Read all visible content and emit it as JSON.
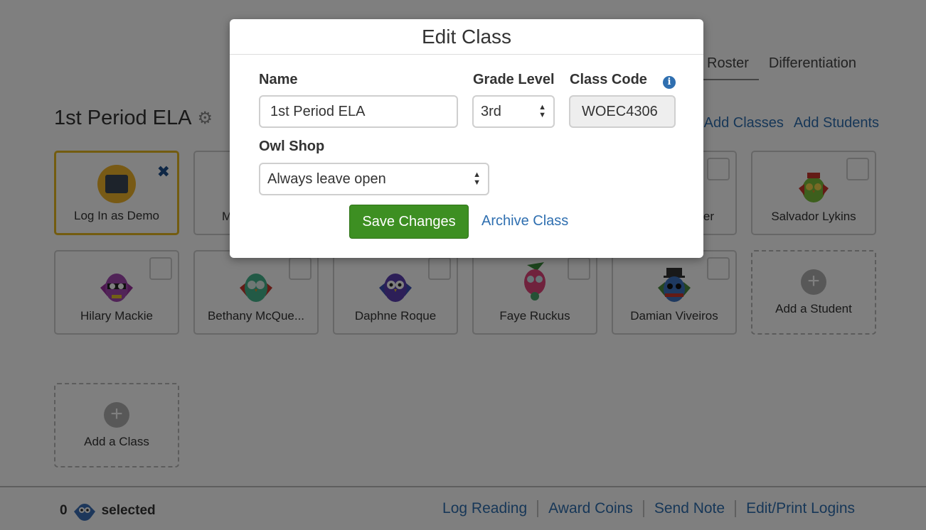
{
  "tabs": [
    {
      "label": "Roster",
      "active": true
    },
    {
      "label": "Differentiation",
      "active": false
    }
  ],
  "class_title": "1st Period ELA",
  "top_links": {
    "add_classes": "Add Classes",
    "add_students": "Add Students"
  },
  "cards": {
    "demo": "Log In as Demo",
    "row1_partial_2": "M",
    "row1_partial_5": "er",
    "salvador": "Salvador Lykins",
    "hilary": "Hilary Mackie",
    "bethany": "Bethany McQue...",
    "daphne": "Daphne Roque",
    "faye": "Faye Ruckus",
    "damian": "Damian Viveiros",
    "add_student": "Add a Student",
    "add_class": "Add a Class"
  },
  "bottom_bar": {
    "count": "0",
    "selected_label": "selected",
    "links": [
      "Log Reading",
      "Award Coins",
      "Send Note",
      "Edit/Print Logins"
    ]
  },
  "modal": {
    "title": "Edit Class",
    "name_label": "Name",
    "name_value": "1st Period ELA",
    "grade_label": "Grade Level",
    "grade_value": "3rd",
    "code_label": "Class Code",
    "code_value": "WOEC4306",
    "owl_shop_label": "Owl Shop",
    "owl_shop_value": "Always leave open",
    "save_label": "Save Changes",
    "archive_label": "Archive Class"
  },
  "colors": {
    "link": "#2f6fb0",
    "save_button": "#3d8f22",
    "demo_border": "#e6b820",
    "overlay": "rgba(0,0,0,0.5)"
  }
}
